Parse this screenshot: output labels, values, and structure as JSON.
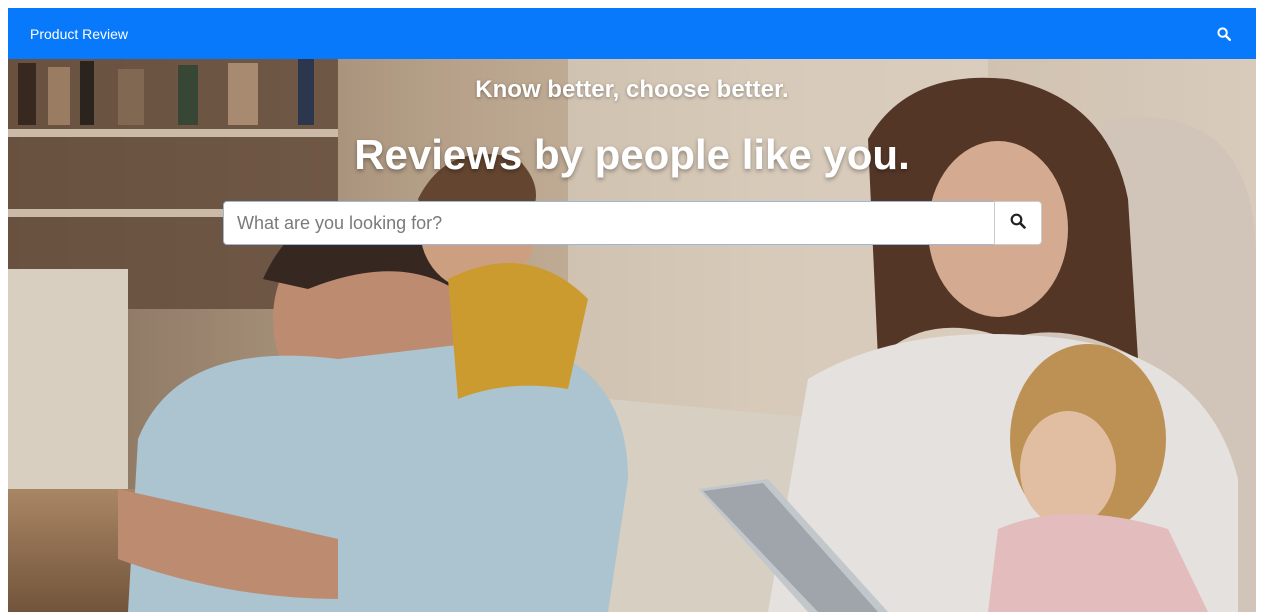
{
  "navbar": {
    "brand": "Product Review",
    "search_icon": "search-icon",
    "color": "#0879fa"
  },
  "hero": {
    "tagline": "Know better, choose better.",
    "headline": "Reviews by people like you.",
    "background": "family-photo"
  },
  "search": {
    "placeholder": "What are you looking for?",
    "value": "",
    "button_icon": "search-icon"
  }
}
